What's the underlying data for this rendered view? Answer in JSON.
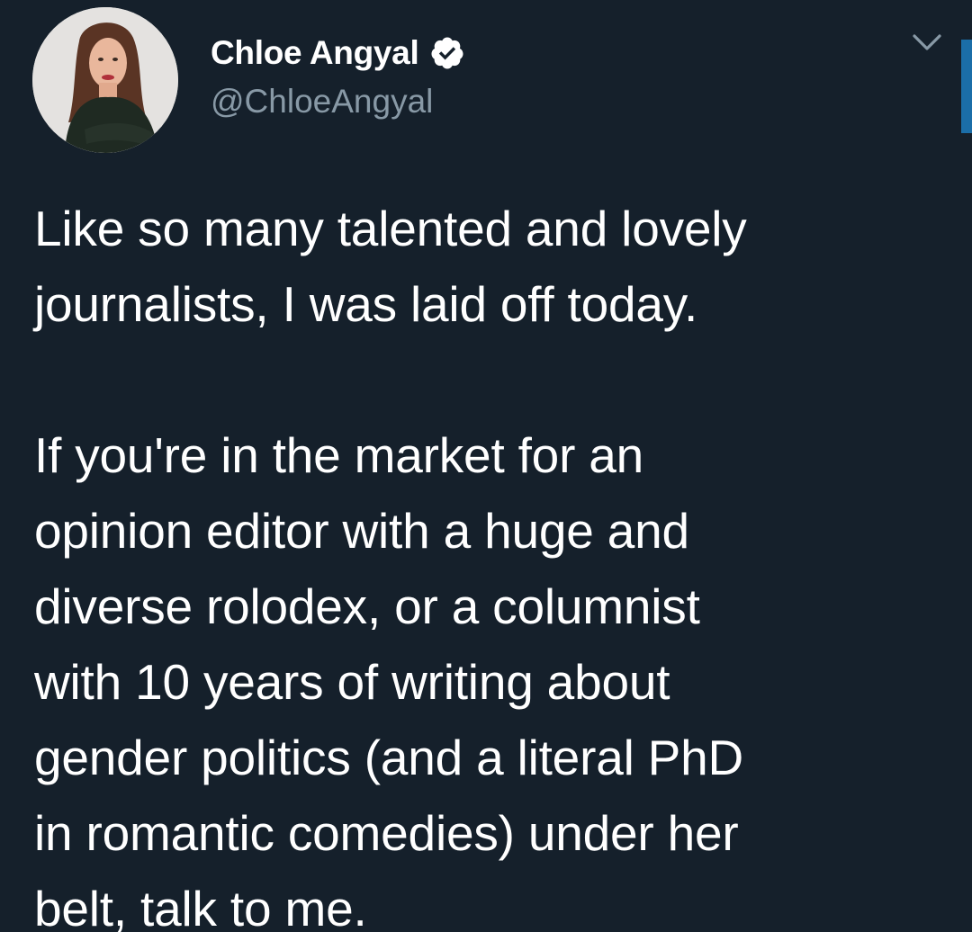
{
  "tweet": {
    "author": {
      "display_name": "Chloe Angyal",
      "handle": "@ChloeAngyal",
      "verified": true,
      "avatar_icon": "profile-photo"
    },
    "menu_icon": "chevron-down-icon",
    "paragraphs": [
      {
        "lines": [
          "Like so many talented and lovely",
          "journalists, I was laid off today."
        ]
      },
      {
        "lines": [
          "If you're in the market for an",
          "opinion editor with a huge and",
          "diverse rolodex, or a columnist",
          "with 10 years of writing about",
          "gender politics (and a literal PhD",
          "in romantic comedies) under her",
          "belt, talk to me."
        ]
      }
    ]
  },
  "colors": {
    "background": "#15202b",
    "text_primary": "#ffffff",
    "text_secondary": "#8899a6",
    "verified_badge": "#ffffff",
    "accent": "#1b6ea8"
  }
}
